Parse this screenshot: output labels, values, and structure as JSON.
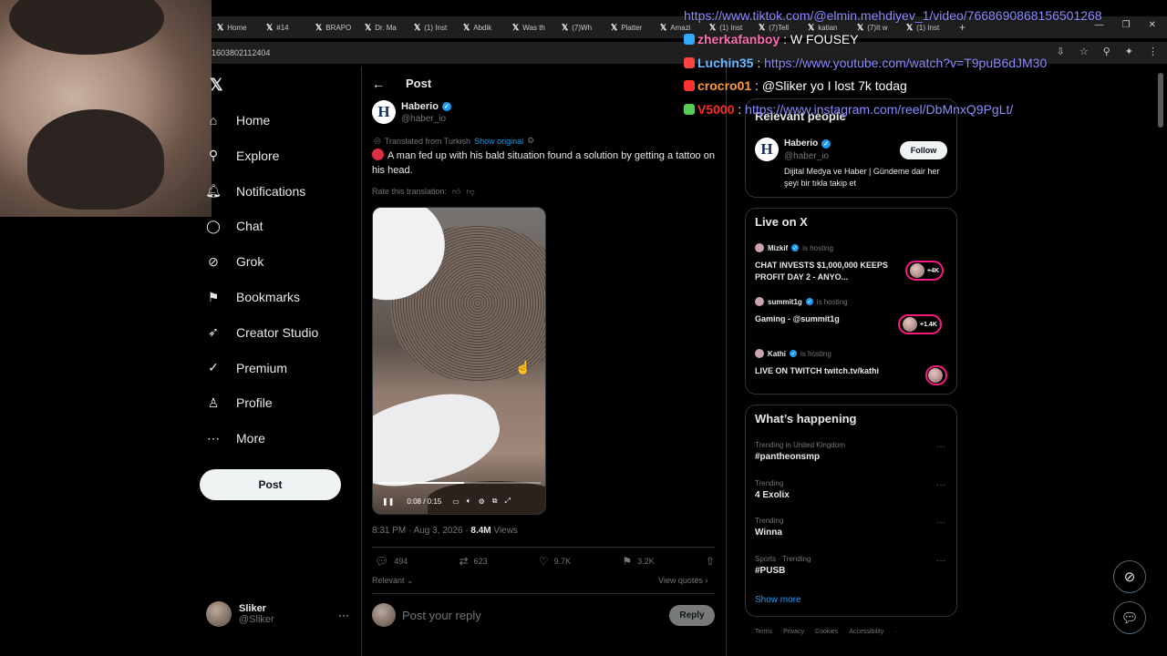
{
  "browser": {
    "tabs": [
      "Home",
      "#14",
      "BRAPO",
      "Dr. Ma",
      "(1) Inst",
      "Abdik",
      "Was th",
      "(7)Wh",
      "Platter",
      "Amazi",
      "(1) Inst",
      "(7)Tell",
      "katian",
      "(7)It w",
      "(1) Inst"
    ],
    "url_fragment": "1603802112404"
  },
  "sidebar": {
    "items": [
      {
        "label": "Home",
        "icon": "home-icon"
      },
      {
        "label": "Explore",
        "icon": "search-icon"
      },
      {
        "label": "Notifications",
        "icon": "bell-icon"
      },
      {
        "label": "Chat",
        "icon": "chat-icon"
      },
      {
        "label": "Grok",
        "icon": "grok-icon"
      },
      {
        "label": "Bookmarks",
        "icon": "bookmark-icon"
      },
      {
        "label": "Creator Studio",
        "icon": "rocket-icon"
      },
      {
        "label": "Premium",
        "icon": "verified-icon"
      },
      {
        "label": "Profile",
        "icon": "person-icon"
      },
      {
        "label": "More",
        "icon": "more-circle-icon"
      }
    ],
    "post_button": "Post",
    "account": {
      "name": "Sliker",
      "handle": "@Sliker"
    }
  },
  "main": {
    "title": "Post",
    "author": {
      "name": "Haberio",
      "handle": "@haber_io",
      "avatar_letter": "H"
    },
    "translated_label": "Translated from Turkish",
    "show_original": "Show original",
    "text": "A man fed up with his bald situation found a solution by getting a tattoo on his head.",
    "rate_label": "Rate this translation:",
    "video": {
      "time": "0:08 / 0:15",
      "progress": 0.53
    },
    "timestamp": "8:31 PM · Aug 3, 2026 ·",
    "views_count": "8.4M",
    "views_label": "Views",
    "stats": {
      "replies": "494",
      "reposts": "623",
      "likes": "9.7K",
      "bookmarks": "3.2K"
    },
    "relevant": "Relevant",
    "view_quotes": "View quotes",
    "reply_placeholder": "Post your reply",
    "reply_button": "Reply"
  },
  "right": {
    "relevant_people": {
      "title": "Relevant people",
      "name": "Haberio",
      "handle": "@haber_io",
      "bio": "Dijital Medya ve Haber | Gündeme dair her şeyi bir tıkla takip et",
      "follow": "Follow"
    },
    "live": {
      "title": "Live on X",
      "hosting": "is hosting",
      "items": [
        {
          "host": "Mizkif",
          "title": "CHAT INVESTS $1,000,000 KEEPS PROFIT DAY 2 - ANYO...",
          "listeners": "+4K"
        },
        {
          "host": "summit1g",
          "title": "Gaming - @summit1g",
          "listeners": "+1.4K"
        },
        {
          "host": "Kathi",
          "title": "LIVE ON TWITCH twitch.tv/kathi",
          "listeners": ""
        }
      ]
    },
    "happening": {
      "title": "What’s happening",
      "trends": [
        {
          "category": "Trending in United Kingdom",
          "name": "#pantheonsmp"
        },
        {
          "category": "Trending",
          "name": "4 Exolix"
        },
        {
          "category": "Trending",
          "name": "Winna"
        },
        {
          "category": "Sports · Trending",
          "name": "#PUSB"
        }
      ],
      "show_more": "Show more"
    },
    "footer": [
      "Terms",
      "Privacy",
      "Cookies",
      "Accessibility",
      "·"
    ]
  },
  "chat_overlay": {
    "lines": [
      {
        "user": "",
        "msg": "https://www.tiktok.com/@elmin.mehdiyev_1/video/7668690868156501268",
        "user_color": "#ffffff",
        "is_link": true
      },
      {
        "user": "zherkafanboy",
        "msg": "W FOUSEY",
        "user_color": "#ff6fb1",
        "is_link": false
      },
      {
        "user": "Luchin35",
        "msg": "https://www.youtube.com/watch?v=T9puB6dJM30",
        "user_color": "#6ab8ff",
        "is_link": true
      },
      {
        "user": "crocro01",
        "msg": "@Sliker yo I lost 7k todag",
        "user_color": "#ff9a3c",
        "is_link": false
      },
      {
        "user": "V5000",
        "msg": "https://www.instagram.com/reel/DbMnxQ9PgLt/",
        "user_color": "#ff2b2b",
        "is_link": true
      }
    ]
  }
}
